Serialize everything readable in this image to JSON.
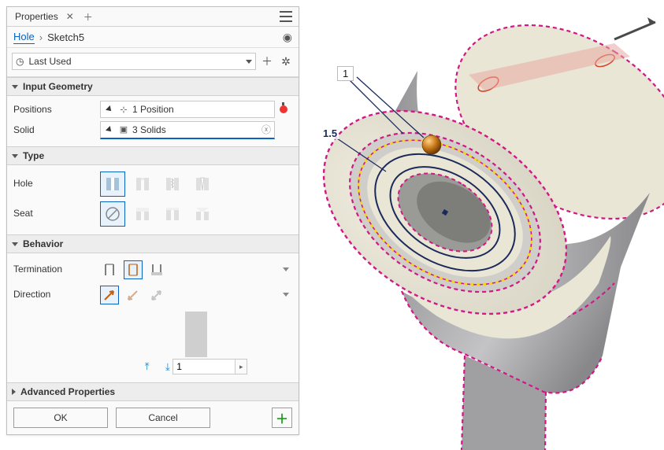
{
  "panel": {
    "title": "Properties",
    "breadcrumb": {
      "root": "Hole",
      "current": "Sketch5"
    },
    "preset": "Last Used"
  },
  "sections": {
    "input_geometry": "Input Geometry",
    "type": "Type",
    "behavior": "Behavior",
    "advanced": "Advanced Properties"
  },
  "fields": {
    "positions_label": "Positions",
    "positions_value": "1 Position",
    "solid_label": "Solid",
    "solid_value": "3 Solids",
    "hole_label": "Hole",
    "seat_label": "Seat",
    "termination_label": "Termination",
    "direction_label": "Direction",
    "depth_value": "1"
  },
  "buttons": {
    "ok": "OK",
    "cancel": "Cancel"
  },
  "viewport": {
    "dim_outer": "1",
    "dim_inner": "1.5"
  }
}
